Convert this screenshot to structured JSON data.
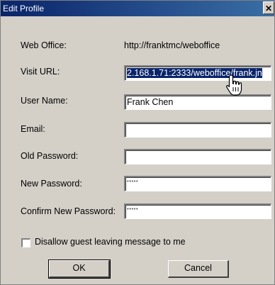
{
  "window": {
    "title": "Edit Profile",
    "close_glyph": "✕"
  },
  "form": {
    "web_office_label": "Web Office:",
    "web_office_value": "http://franktmc/weboffice",
    "visit_url_label": "Visit URL:",
    "visit_url_value": "2.168.1.71:2333/weboffice/frank.jn",
    "user_name_label": "User Name:",
    "user_name_value": "Frank Chen",
    "email_label": "Email:",
    "email_value": "",
    "old_password_label": "Old Password:",
    "old_password_value": "",
    "new_password_label": "New Password:",
    "new_password_value": "*****",
    "confirm_password_label": "Confirm New Password:",
    "confirm_password_value": "*****",
    "guest_message_label": "Disallow guest leaving message to me",
    "guest_message_checked": false
  },
  "buttons": {
    "ok_label": "OK",
    "cancel_label": "Cancel"
  },
  "icons": {
    "close": "close-icon",
    "cursor": "hand-pointer-icon",
    "checkbox": "checkbox-icon"
  }
}
